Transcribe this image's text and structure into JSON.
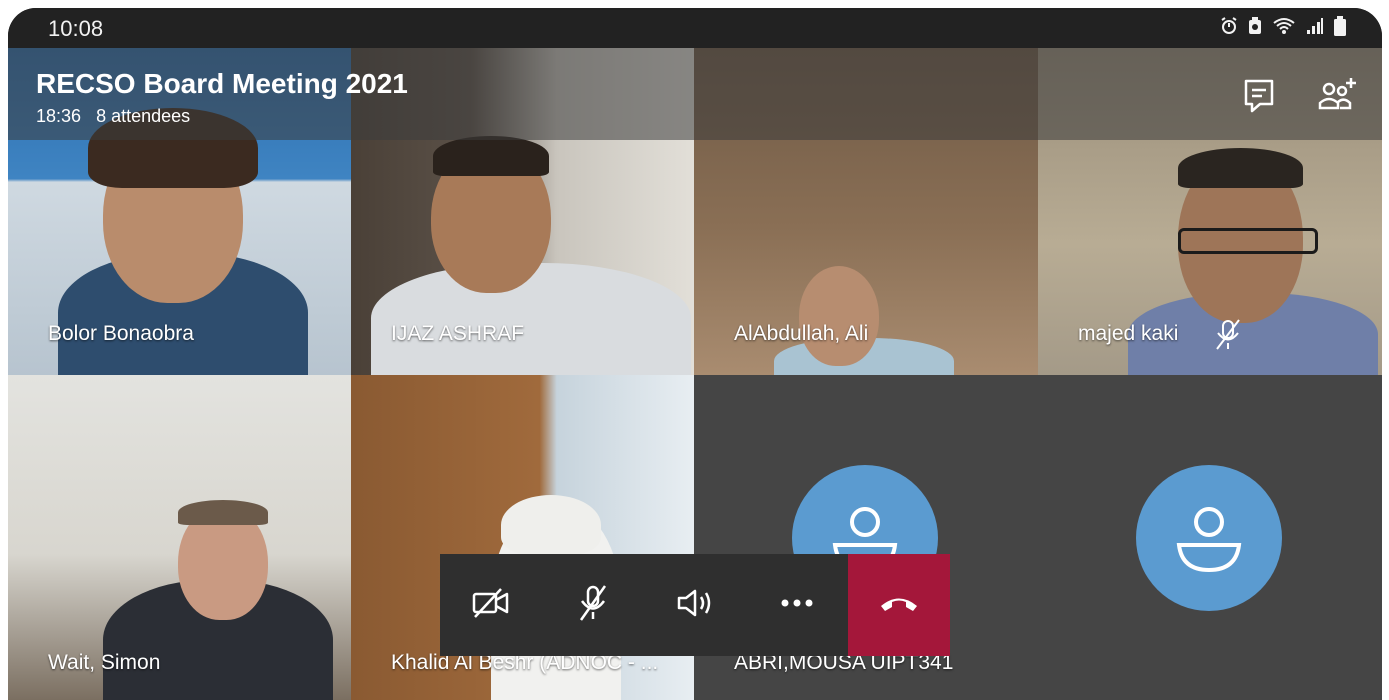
{
  "status_bar": {
    "time": "10:08",
    "icons": [
      "alarm-icon",
      "battery-saver-icon",
      "wifi-icon",
      "signal-icon",
      "battery-icon"
    ]
  },
  "meeting": {
    "title": "RECSO Board Meeting 2021",
    "elapsed": "18:36",
    "attendees": "8 attendees",
    "actions": [
      "chat-icon",
      "add-people-icon"
    ]
  },
  "participants": [
    {
      "name": "Bolor Bonaobra",
      "video": true,
      "muted": false
    },
    {
      "name": "IJAZ ASHRAF",
      "video": true,
      "muted": false
    },
    {
      "name": "AlAbdullah, Ali",
      "video": true,
      "muted": false
    },
    {
      "name": "majed kaki",
      "video": true,
      "muted": true
    },
    {
      "name": "Wait, Simon",
      "video": true,
      "muted": false
    },
    {
      "name": "Khalid Al Beshr (ADNOC - ...",
      "video": true,
      "muted": false
    },
    {
      "name": "ABRI,MOUSA UIPT341",
      "video": false,
      "muted": false
    },
    {
      "name": "",
      "video": false,
      "muted": false
    }
  ],
  "controls": [
    "camera-off-icon",
    "mic-off-icon",
    "speaker-icon",
    "more-icon",
    "hang-up-icon"
  ],
  "colors": {
    "hangup": "#a4173a",
    "avatar": "#5b9bd0",
    "tile_empty": "#454545",
    "control_bar": "#2f2f2f"
  }
}
